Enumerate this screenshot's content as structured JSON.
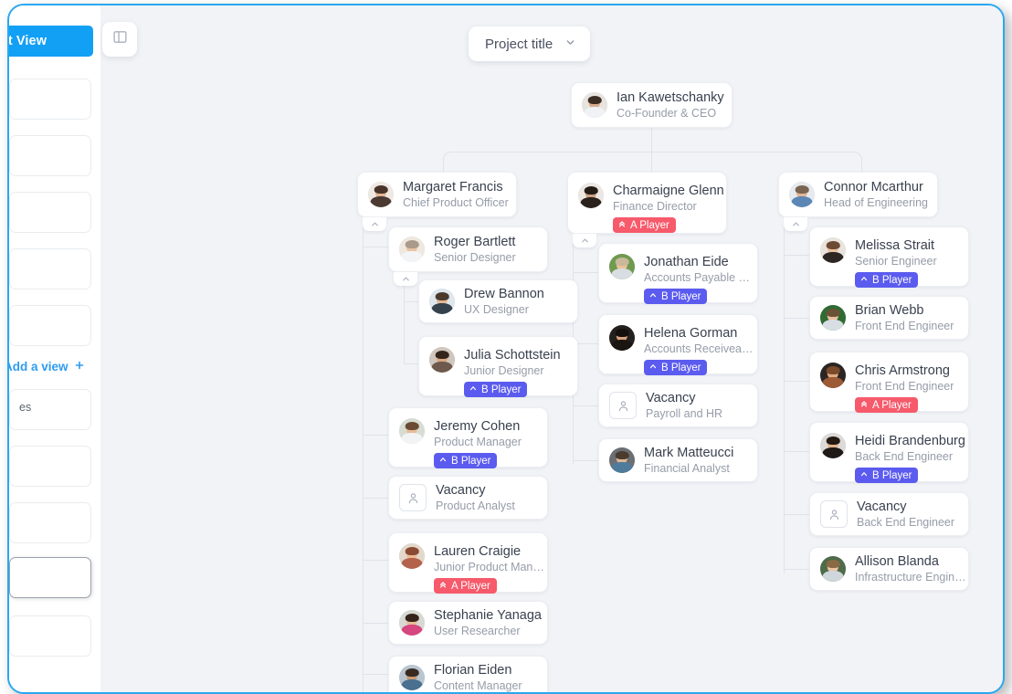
{
  "window": {
    "border_color": "#29a8f0",
    "canvas_bg": "#f1f3f7"
  },
  "sidebar": {
    "edit_view_label": "Edit View",
    "add_view_label": "Add a view",
    "items": [
      {
        "label": ""
      },
      {
        "label": ""
      },
      {
        "label": ""
      },
      {
        "label": ""
      },
      {
        "label": "es"
      },
      {
        "label": ""
      },
      {
        "label": ""
      },
      {
        "label": ""
      },
      {
        "label": ""
      }
    ]
  },
  "toolbar": {
    "panel_toggle_icon": "sidebar-panel-icon",
    "project_title": "Project title",
    "project_title_chevron": "chevron-down-icon"
  },
  "badges": {
    "a_player": {
      "label": "A Player",
      "color": "#f65a6b",
      "icon": "double-chevron-up-icon"
    },
    "b_player": {
      "label": "B Player",
      "color": "#5b5bef",
      "icon": "chevron-up-icon"
    }
  },
  "chart_data": {
    "type": "org-chart",
    "title": "Project title",
    "root": {
      "name": "Ian Kawetschanky",
      "role": "Co-Founder & CEO",
      "badge": null,
      "avatar": "photo"
    },
    "branches": [
      {
        "manager": {
          "name": "Margaret Francis",
          "role": "Chief Product Officer",
          "badge": null,
          "avatar": "photo",
          "collapsible": true
        },
        "reports": [
          {
            "name": "Roger Bartlett",
            "role": "Senior Designer",
            "badge": null,
            "avatar": "photo",
            "collapsible": true,
            "reports": [
              {
                "name": "Drew Bannon",
                "role": "UX Designer",
                "badge": null,
                "avatar": "photo"
              },
              {
                "name": "Julia Schottstein",
                "role": "Junior Designer",
                "badge": "B Player",
                "avatar": "photo"
              }
            ]
          },
          {
            "name": "Jeremy Cohen",
            "role": "Product Manager",
            "badge": "B Player",
            "avatar": "photo"
          },
          {
            "name": "Vacancy",
            "role": "Product Analyst",
            "badge": null,
            "avatar": "vacancy"
          },
          {
            "name": "Lauren Craigie",
            "role": "Junior Product Manager",
            "badge": "A Player",
            "avatar": "photo"
          },
          {
            "name": "Stephanie Yanaga",
            "role": "User Researcher",
            "badge": null,
            "avatar": "photo"
          },
          {
            "name": "Florian Eiden",
            "role": "Content Manager",
            "badge": null,
            "avatar": "photo"
          }
        ]
      },
      {
        "manager": {
          "name": "Charmaigne Glenn",
          "role": "Finance Director",
          "badge": "A Player",
          "avatar": "photo",
          "collapsible": true
        },
        "reports": [
          {
            "name": "Jonathan Eide",
            "role": "Accounts Payable Officer",
            "badge": "B Player",
            "avatar": "photo"
          },
          {
            "name": "Helena Gorman",
            "role": "Accounts Receiveable O...",
            "badge": "B Player",
            "avatar": "photo"
          },
          {
            "name": "Vacancy",
            "role": "Payroll and HR",
            "badge": null,
            "avatar": "vacancy"
          },
          {
            "name": "Mark Matteucci",
            "role": "Financial Analyst",
            "badge": null,
            "avatar": "photo"
          }
        ]
      },
      {
        "manager": {
          "name": "Connor Mcarthur",
          "role": "Head of Engineering",
          "badge": null,
          "avatar": "photo",
          "collapsible": true
        },
        "reports": [
          {
            "name": "Melissa Strait",
            "role": "Senior Engineer",
            "badge": "B Player",
            "avatar": "photo"
          },
          {
            "name": "Brian Webb",
            "role": "Front End Engineer",
            "badge": null,
            "avatar": "photo"
          },
          {
            "name": "Chris Armstrong",
            "role": "Front End Engineer",
            "badge": "A Player",
            "avatar": "photo"
          },
          {
            "name": "Heidi Brandenburg",
            "role": "Back End Engineer",
            "badge": "B Player",
            "avatar": "photo"
          },
          {
            "name": "Vacancy",
            "role": "Back End Engineer",
            "badge": null,
            "avatar": "vacancy"
          },
          {
            "name": "Allison Blanda",
            "role": "Infrastructure Engineer",
            "badge": null,
            "avatar": "photo"
          }
        ]
      }
    ]
  },
  "nodes": {
    "root": {
      "name": "Ian Kawetschanky",
      "role": "Co-Founder & CEO"
    },
    "m1": {
      "name": "Margaret Francis",
      "role": "Chief Product Officer"
    },
    "m2": {
      "name": "Charmaigne Glenn",
      "role": "Finance Director"
    },
    "m3": {
      "name": "Connor Mcarthur",
      "role": "Head of Engineering"
    },
    "a1": {
      "name": "Roger Bartlett",
      "role": "Senior Designer"
    },
    "a2": {
      "name": "Drew Bannon",
      "role": "UX Designer"
    },
    "a3": {
      "name": "Julia Schottstein",
      "role": "Junior Designer"
    },
    "a4": {
      "name": "Jeremy Cohen",
      "role": "Product Manager"
    },
    "a5": {
      "name": "Vacancy",
      "role": "Product Analyst"
    },
    "a6": {
      "name": "Lauren Craigie",
      "role": "Junior Product Manager"
    },
    "a7": {
      "name": "Stephanie Yanaga",
      "role": "User Researcher"
    },
    "a8": {
      "name": "Florian Eiden",
      "role": "Content Manager"
    },
    "b1": {
      "name": "Jonathan Eide",
      "role": "Accounts Payable Officer"
    },
    "b2": {
      "name": "Helena Gorman",
      "role": "Accounts Receiveable O..."
    },
    "b3": {
      "name": "Vacancy",
      "role": "Payroll and HR"
    },
    "b4": {
      "name": "Mark Matteucci",
      "role": "Financial Analyst"
    },
    "c1": {
      "name": "Melissa Strait",
      "role": "Senior Engineer"
    },
    "c2": {
      "name": "Brian Webb",
      "role": "Front End Engineer"
    },
    "c3": {
      "name": "Chris Armstrong",
      "role": "Front End Engineer"
    },
    "c4": {
      "name": "Heidi Brandenburg",
      "role": "Back End Engineer"
    },
    "c5": {
      "name": "Vacancy",
      "role": "Back End Engineer"
    },
    "c6": {
      "name": "Allison Blanda",
      "role": "Infrastructure Engineer"
    }
  }
}
